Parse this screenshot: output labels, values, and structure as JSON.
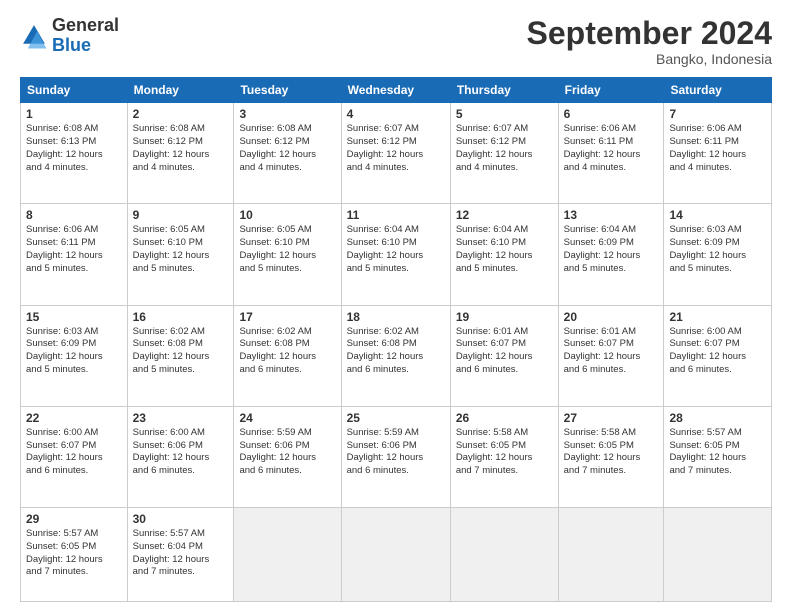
{
  "logo": {
    "general": "General",
    "blue": "Blue"
  },
  "header": {
    "title": "September 2024",
    "subtitle": "Bangko, Indonesia"
  },
  "weekdays": [
    "Sunday",
    "Monday",
    "Tuesday",
    "Wednesday",
    "Thursday",
    "Friday",
    "Saturday"
  ],
  "weeks": [
    [
      {
        "day": "1",
        "info": "Sunrise: 6:08 AM\nSunset: 6:13 PM\nDaylight: 12 hours\nand 4 minutes."
      },
      {
        "day": "2",
        "info": "Sunrise: 6:08 AM\nSunset: 6:12 PM\nDaylight: 12 hours\nand 4 minutes."
      },
      {
        "day": "3",
        "info": "Sunrise: 6:08 AM\nSunset: 6:12 PM\nDaylight: 12 hours\nand 4 minutes."
      },
      {
        "day": "4",
        "info": "Sunrise: 6:07 AM\nSunset: 6:12 PM\nDaylight: 12 hours\nand 4 minutes."
      },
      {
        "day": "5",
        "info": "Sunrise: 6:07 AM\nSunset: 6:12 PM\nDaylight: 12 hours\nand 4 minutes."
      },
      {
        "day": "6",
        "info": "Sunrise: 6:06 AM\nSunset: 6:11 PM\nDaylight: 12 hours\nand 4 minutes."
      },
      {
        "day": "7",
        "info": "Sunrise: 6:06 AM\nSunset: 6:11 PM\nDaylight: 12 hours\nand 4 minutes."
      }
    ],
    [
      {
        "day": "8",
        "info": "Sunrise: 6:06 AM\nSunset: 6:11 PM\nDaylight: 12 hours\nand 5 minutes."
      },
      {
        "day": "9",
        "info": "Sunrise: 6:05 AM\nSunset: 6:10 PM\nDaylight: 12 hours\nand 5 minutes."
      },
      {
        "day": "10",
        "info": "Sunrise: 6:05 AM\nSunset: 6:10 PM\nDaylight: 12 hours\nand 5 minutes."
      },
      {
        "day": "11",
        "info": "Sunrise: 6:04 AM\nSunset: 6:10 PM\nDaylight: 12 hours\nand 5 minutes."
      },
      {
        "day": "12",
        "info": "Sunrise: 6:04 AM\nSunset: 6:10 PM\nDaylight: 12 hours\nand 5 minutes."
      },
      {
        "day": "13",
        "info": "Sunrise: 6:04 AM\nSunset: 6:09 PM\nDaylight: 12 hours\nand 5 minutes."
      },
      {
        "day": "14",
        "info": "Sunrise: 6:03 AM\nSunset: 6:09 PM\nDaylight: 12 hours\nand 5 minutes."
      }
    ],
    [
      {
        "day": "15",
        "info": "Sunrise: 6:03 AM\nSunset: 6:09 PM\nDaylight: 12 hours\nand 5 minutes."
      },
      {
        "day": "16",
        "info": "Sunrise: 6:02 AM\nSunset: 6:08 PM\nDaylight: 12 hours\nand 5 minutes."
      },
      {
        "day": "17",
        "info": "Sunrise: 6:02 AM\nSunset: 6:08 PM\nDaylight: 12 hours\nand 6 minutes."
      },
      {
        "day": "18",
        "info": "Sunrise: 6:02 AM\nSunset: 6:08 PM\nDaylight: 12 hours\nand 6 minutes."
      },
      {
        "day": "19",
        "info": "Sunrise: 6:01 AM\nSunset: 6:07 PM\nDaylight: 12 hours\nand 6 minutes."
      },
      {
        "day": "20",
        "info": "Sunrise: 6:01 AM\nSunset: 6:07 PM\nDaylight: 12 hours\nand 6 minutes."
      },
      {
        "day": "21",
        "info": "Sunrise: 6:00 AM\nSunset: 6:07 PM\nDaylight: 12 hours\nand 6 minutes."
      }
    ],
    [
      {
        "day": "22",
        "info": "Sunrise: 6:00 AM\nSunset: 6:07 PM\nDaylight: 12 hours\nand 6 minutes."
      },
      {
        "day": "23",
        "info": "Sunrise: 6:00 AM\nSunset: 6:06 PM\nDaylight: 12 hours\nand 6 minutes."
      },
      {
        "day": "24",
        "info": "Sunrise: 5:59 AM\nSunset: 6:06 PM\nDaylight: 12 hours\nand 6 minutes."
      },
      {
        "day": "25",
        "info": "Sunrise: 5:59 AM\nSunset: 6:06 PM\nDaylight: 12 hours\nand 6 minutes."
      },
      {
        "day": "26",
        "info": "Sunrise: 5:58 AM\nSunset: 6:05 PM\nDaylight: 12 hours\nand 7 minutes."
      },
      {
        "day": "27",
        "info": "Sunrise: 5:58 AM\nSunset: 6:05 PM\nDaylight: 12 hours\nand 7 minutes."
      },
      {
        "day": "28",
        "info": "Sunrise: 5:57 AM\nSunset: 6:05 PM\nDaylight: 12 hours\nand 7 minutes."
      }
    ],
    [
      {
        "day": "29",
        "info": "Sunrise: 5:57 AM\nSunset: 6:05 PM\nDaylight: 12 hours\nand 7 minutes."
      },
      {
        "day": "30",
        "info": "Sunrise: 5:57 AM\nSunset: 6:04 PM\nDaylight: 12 hours\nand 7 minutes."
      },
      {
        "day": "",
        "info": ""
      },
      {
        "day": "",
        "info": ""
      },
      {
        "day": "",
        "info": ""
      },
      {
        "day": "",
        "info": ""
      },
      {
        "day": "",
        "info": ""
      }
    ]
  ]
}
